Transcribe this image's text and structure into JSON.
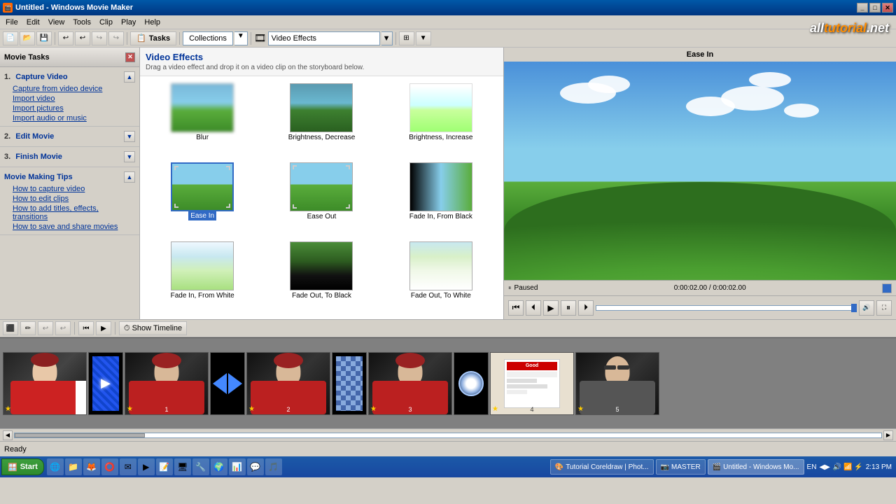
{
  "window": {
    "title": "Untitled - Windows Movie Maker",
    "icon": "🎬"
  },
  "menubar": {
    "items": [
      "File",
      "Edit",
      "View",
      "Tools",
      "Clip",
      "Play",
      "Help"
    ]
  },
  "toolbar": {
    "tasks_label": "Tasks",
    "collections_label": "Collections",
    "video_effects_option": "Video Effects",
    "undo_icon": "↩",
    "redo_icon": "↪"
  },
  "left_panel": {
    "header": "Movie Tasks",
    "sections": [
      {
        "number": "1.",
        "title": "Capture Video",
        "links": [
          "Capture from video device",
          "Import video",
          "Import pictures",
          "Import audio or music"
        ]
      },
      {
        "number": "2.",
        "title": "Edit Movie",
        "links": []
      },
      {
        "number": "3.",
        "title": "Finish Movie",
        "links": []
      },
      {
        "number": "",
        "title": "Movie Making Tips",
        "links": [
          "How to capture video",
          "How to edit clips",
          "How to add titles, effects, transitions",
          "How to save and share movies"
        ]
      }
    ]
  },
  "effects_panel": {
    "title": "Video Effects",
    "subtitle": "Drag a video effect and drop it on a video clip on the storyboard below.",
    "effects": [
      {
        "id": "blur",
        "label": "Blur",
        "style": "blur"
      },
      {
        "id": "brightness-decrease",
        "label": "Brightness, Decrease",
        "style": "normal"
      },
      {
        "id": "brightness-increase",
        "label": "Brightness, Increase",
        "style": "bright"
      },
      {
        "id": "ease-in",
        "label": "Ease In",
        "style": "ease-in",
        "selected": true
      },
      {
        "id": "ease-out",
        "label": "Ease Out",
        "style": "normal"
      },
      {
        "id": "fade-from-black",
        "label": "Fade In, From Black",
        "style": "fade-black"
      },
      {
        "id": "fade-from-white",
        "label": "Fade In, From White",
        "style": "fade-white"
      },
      {
        "id": "fadeout-to-black",
        "label": "Fade Out, To Black",
        "style": "fadeout-black"
      },
      {
        "id": "fadeout-to-white",
        "label": "Fade Out, To White",
        "style": "fadeout-white"
      }
    ]
  },
  "preview": {
    "title": "Ease In",
    "status": "Paused",
    "time_current": "0:00:02.00",
    "time_total": "0:00:02.00",
    "time_display": "0:00:02.00 / 0:00:02.00"
  },
  "storyboard": {
    "toolbar_label": "Show Timeline",
    "clips": [
      {
        "id": 0,
        "label": "",
        "has_star": true,
        "type": "person"
      },
      {
        "id": 1,
        "label": "1",
        "has_star": true,
        "type": "person",
        "transition": "compress"
      },
      {
        "id": 2,
        "label": "2",
        "has_star": true,
        "type": "person",
        "transition": "arrow-left"
      },
      {
        "id": 3,
        "label": "3",
        "has_star": true,
        "type": "person",
        "transition": "checker"
      },
      {
        "id": 4,
        "label": "4",
        "has_star": true,
        "type": "magazine",
        "transition": "circle"
      },
      {
        "id": 5,
        "label": "5",
        "has_star": true,
        "type": "glasses"
      }
    ]
  },
  "statusbar": {
    "text": "Ready"
  },
  "taskbar": {
    "start_label": "Start",
    "apps": [
      {
        "label": "Tutorial Coreldraw | Phot...",
        "active": false
      },
      {
        "label": "MASTER",
        "active": false
      },
      {
        "label": "Untitled - Windows Mo...",
        "active": true
      }
    ],
    "tray": {
      "lang": "EN",
      "time": "2:13 PM"
    }
  },
  "logo": {
    "text1": "alltut",
    "text2": "orial",
    "suffix": ".net"
  }
}
